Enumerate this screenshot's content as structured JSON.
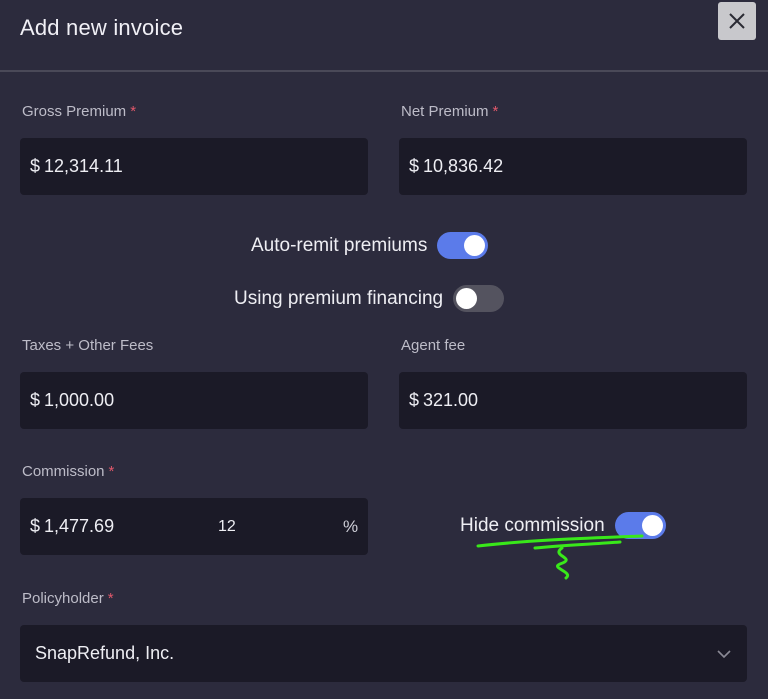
{
  "dialog": {
    "title": "Add new invoice",
    "close_icon": "close-icon"
  },
  "gross_premium": {
    "label": "Gross Premium",
    "required": "*",
    "currency": "$",
    "value": "12,314.11"
  },
  "net_premium": {
    "label": "Net Premium",
    "required": "*",
    "currency": "$",
    "value": "10,836.42"
  },
  "auto_remit": {
    "label": "Auto-remit premiums",
    "on": true
  },
  "premium_financing": {
    "label": "Using premium financing",
    "on": false
  },
  "taxes_fees": {
    "label": "Taxes + Other Fees",
    "currency": "$",
    "value": "1,000.00"
  },
  "agent_fee": {
    "label": "Agent fee",
    "currency": "$",
    "value": "321.00"
  },
  "commission": {
    "label": "Commission",
    "required": "*",
    "currency": "$",
    "value": "1,477.69",
    "percent": "12",
    "percent_sign": "%"
  },
  "hide_commission": {
    "label": "Hide commission",
    "on": true
  },
  "policyholder": {
    "label": "Policyholder",
    "required": "*",
    "value": "SnapRefund, Inc.",
    "dropdown_icon": "chevron-down-icon"
  },
  "colors": {
    "background": "#2c2b3d",
    "field": "#1b1a27",
    "accent": "#5b7bea",
    "required": "#e0586b",
    "annotation": "#39e81a"
  }
}
